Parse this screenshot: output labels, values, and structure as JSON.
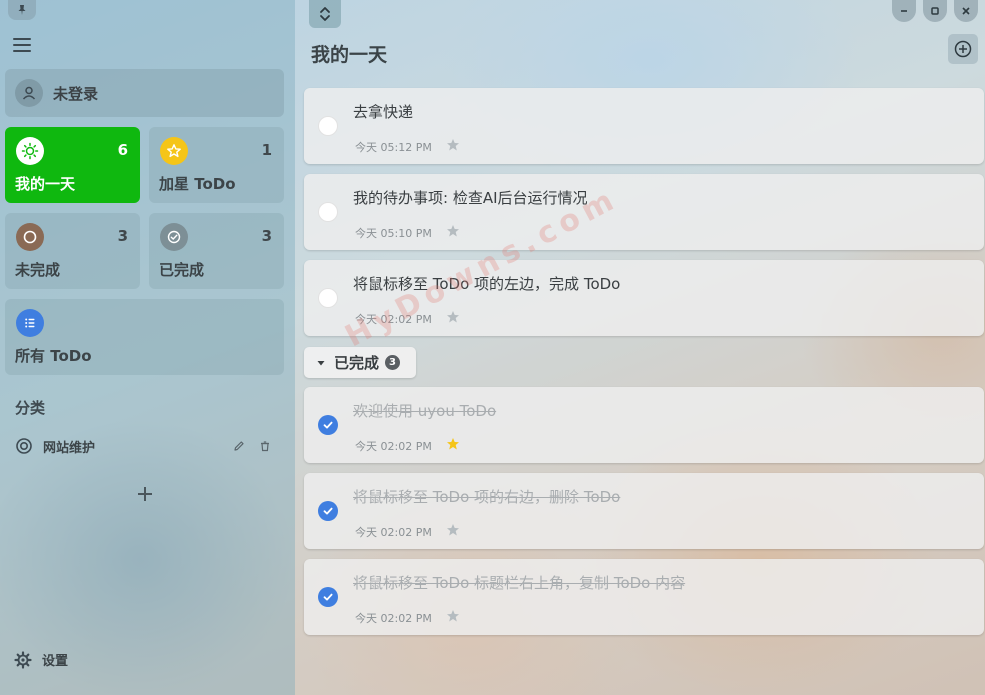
{
  "sidebar": {
    "login_label": "未登录",
    "tiles": [
      {
        "name": "我的一天",
        "count": "6"
      },
      {
        "name": "加星 ToDo",
        "count": "1"
      },
      {
        "name": "未完成",
        "count": "3"
      },
      {
        "name": "已完成",
        "count": "3"
      },
      {
        "name": "所有 ToDo",
        "count": ""
      }
    ],
    "section_title": "分类",
    "categories": [
      {
        "name": "网站维护"
      }
    ],
    "add_category_symbol": "+",
    "settings_label": "设置"
  },
  "main": {
    "title": "我的一天",
    "todos": [
      {
        "title": "去拿快递",
        "time": "今天 05:12 PM",
        "starred": false
      },
      {
        "title": "我的待办事项: 检查AI后台运行情况",
        "time": "今天 05:10 PM",
        "starred": false
      },
      {
        "title": "将鼠标移至 ToDo 项的左边，完成 ToDo",
        "time": "今天 02:02 PM",
        "starred": false
      }
    ],
    "completed_header": {
      "label": "已完成",
      "count": "3"
    },
    "completed": [
      {
        "title": "欢迎使用 uyou ToDo",
        "time": "今天 02:02 PM",
        "starred": true
      },
      {
        "title": "将鼠标移至 ToDo 项的右边，删除 ToDo",
        "time": "今天 02:02 PM",
        "starred": false
      },
      {
        "title": "将鼠标移至 ToDo 标题栏右上角，复制 ToDo 内容",
        "time": "今天 02:02 PM",
        "starred": false
      }
    ]
  },
  "watermark": "HyDowns.com",
  "colors": {
    "my_day_tile": "#0fb80f",
    "starred_icon": "#f5c518",
    "incomplete_icon": "#8a6a55",
    "completed_icon": "#7d8f96",
    "all_icon": "#3f7ee0",
    "check_done": "#3f7ee0",
    "star_active": "#f5c518",
    "star_inactive": "#b5bcc0"
  }
}
